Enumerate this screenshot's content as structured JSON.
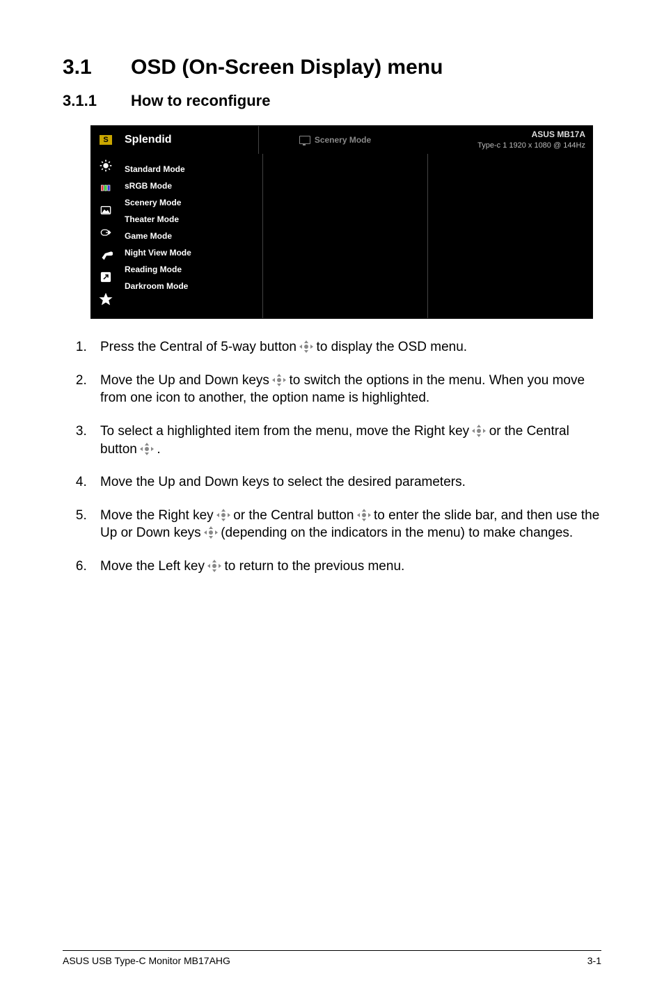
{
  "section": {
    "num": "3.1",
    "title": "OSD (On-Screen Display) menu"
  },
  "subsection": {
    "num": "3.1.1",
    "title": "How to reconfigure"
  },
  "osd": {
    "title": "Splendid",
    "selected_icon_letter": "S",
    "center_label": "Scenery Mode",
    "model": "ASUS MB17A",
    "status": "Type-c 1  1920 x 1080 @ 144Hz",
    "sidebar_icons": [
      "brightness-icon",
      "color-icon",
      "image-icon",
      "input-icon",
      "settings-icon",
      "shortcut-icon",
      "favorite-icon"
    ],
    "list": [
      "Standard Mode",
      "sRGB Mode",
      "Scenery Mode",
      "Theater Mode",
      "Game Mode",
      "Night View Mode",
      "Reading Mode",
      "Darkroom Mode"
    ]
  },
  "steps": {
    "s1a": "Press the Central of 5-way button ",
    "s1b": " to display the OSD menu.",
    "s2a": "Move the Up and Down keys ",
    "s2b": " to switch the options in the menu. When you move from one icon to another, the option name is highlighted.",
    "s3a": "To select a highlighted item from the menu, move the Right key ",
    "s3b": " or the Central button ",
    "s3c": ".",
    "s4": "Move the Up and Down keys to select the desired parameters.",
    "s5a": "Move the Right key ",
    "s5b": " or the Central button ",
    "s5c": " to enter the slide bar, and then use the Up or Down keys ",
    "s5d": " (depending on the indicators in the menu) to make changes.",
    "s6a": "Move the Left key ",
    "s6b": " to return to the previous menu."
  },
  "footer": {
    "left": "ASUS USB Type-C Monitor MB17AHG",
    "right": "3-1"
  }
}
